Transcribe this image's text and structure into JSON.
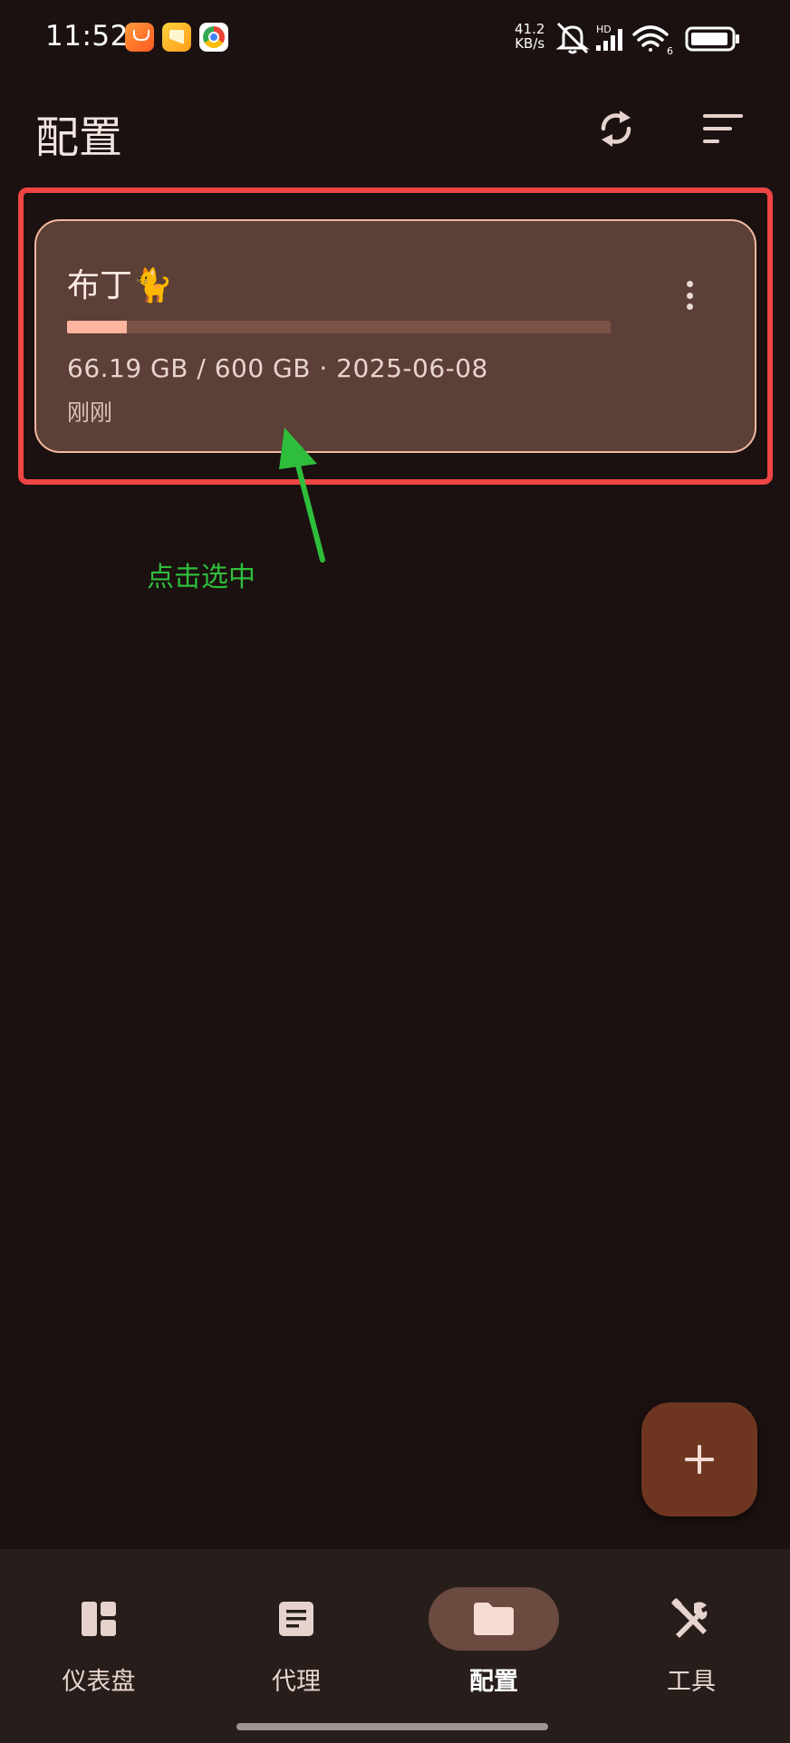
{
  "status_bar": {
    "time": "11:52",
    "net_speed_value": "41.2",
    "net_speed_unit": "KB/s",
    "network_label": "HD",
    "wifi_label": "6",
    "icons": [
      "shopping-app-icon",
      "gallery-app-icon",
      "chrome-app-icon",
      "mute-bell-icon",
      "signal-icon",
      "wifi-icon",
      "battery-icon"
    ]
  },
  "header": {
    "title": "配置",
    "actions": [
      "refresh-icon",
      "sort-icon"
    ]
  },
  "profiles": [
    {
      "name": "布丁🐈",
      "usage": "66.19 GB / 600 GB",
      "separator": "·",
      "expire_date": "2025-06-08",
      "usage_display": "66.19 GB / 600 GB  ·  2025-06-08",
      "updated": "刚刚",
      "used_fraction": 0.11
    }
  ],
  "annotation": {
    "text": "点击选中",
    "color": "#2fbe3c",
    "highlight_color": "#f04545"
  },
  "fab": {
    "icon": "plus-icon"
  },
  "bottom_nav": {
    "items": [
      {
        "label": "仪表盘",
        "icon": "dashboard-icon",
        "active": false
      },
      {
        "label": "代理",
        "icon": "proxy-list-icon",
        "active": false
      },
      {
        "label": "配置",
        "icon": "folder-icon",
        "active": true
      },
      {
        "label": "工具",
        "icon": "tools-icon",
        "active": false
      }
    ]
  },
  "colors": {
    "background": "#1b1110",
    "card": "#5c3f36",
    "card_border": "#f4b8a0",
    "progress_fill": "#ffb49f",
    "fab": "#6e3620",
    "nav_background": "#271d1b",
    "nav_active_pill": "#6b4a40"
  }
}
